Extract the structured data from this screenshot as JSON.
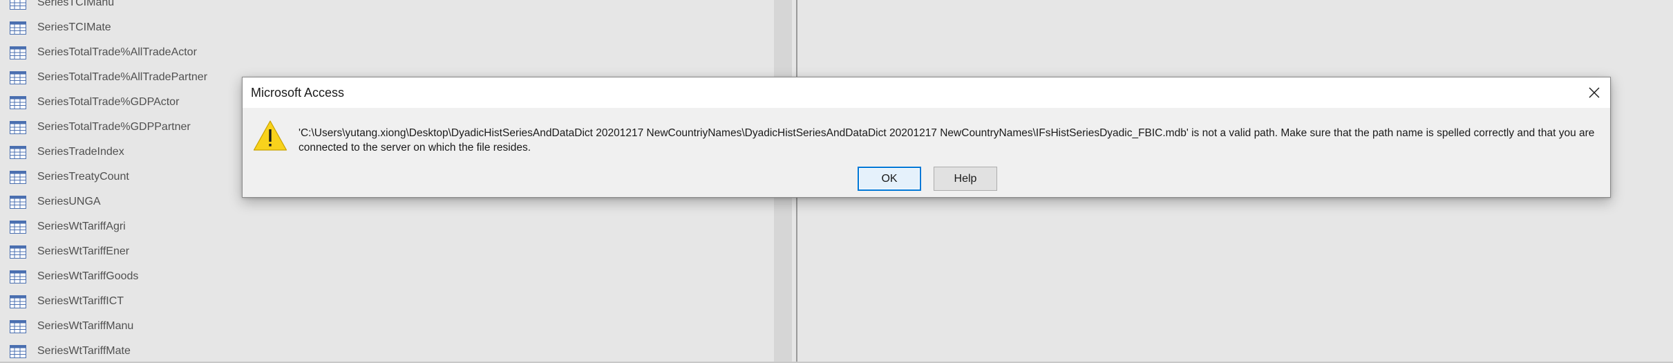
{
  "nav": {
    "items": [
      {
        "label": "SeriesTCIManu"
      },
      {
        "label": "SeriesTCIMate"
      },
      {
        "label": "SeriesTotalTrade%AllTradeActor"
      },
      {
        "label": "SeriesTotalTrade%AllTradePartner"
      },
      {
        "label": "SeriesTotalTrade%GDPActor"
      },
      {
        "label": "SeriesTotalTrade%GDPPartner"
      },
      {
        "label": "SeriesTradeIndex"
      },
      {
        "label": "SeriesTreatyCount"
      },
      {
        "label": "SeriesUNGA"
      },
      {
        "label": "SeriesWtTariffAgri"
      },
      {
        "label": "SeriesWtTariffEner"
      },
      {
        "label": "SeriesWtTariffGoods"
      },
      {
        "label": "SeriesWtTariffICT"
      },
      {
        "label": "SeriesWtTariffManu"
      },
      {
        "label": "SeriesWtTariffMate"
      }
    ],
    "icon": "table-icon",
    "text_color": "#505050"
  },
  "dialog": {
    "title": "Microsoft Access",
    "close_icon": "close-icon",
    "warning_icon": "warning-icon",
    "message_line1": "'C:\\Users\\yutang.xiong\\Desktop\\DyadicHistSeriesAndDataDict 20201217 NewCountriyNames\\DyadicHistSeriesAndDataDict 20201217 NewCountryNames\\IFsHistSeriesDyadic_FBIC.mdb' is not a valid path. Make sure that the path name is spelled correctly and that you are",
    "message_line2": "connected to the server on which the file resides.",
    "ok_label": "OK",
    "help_label": "Help",
    "accent_color": "#0078d7",
    "warning_color": "#f8d21c"
  }
}
